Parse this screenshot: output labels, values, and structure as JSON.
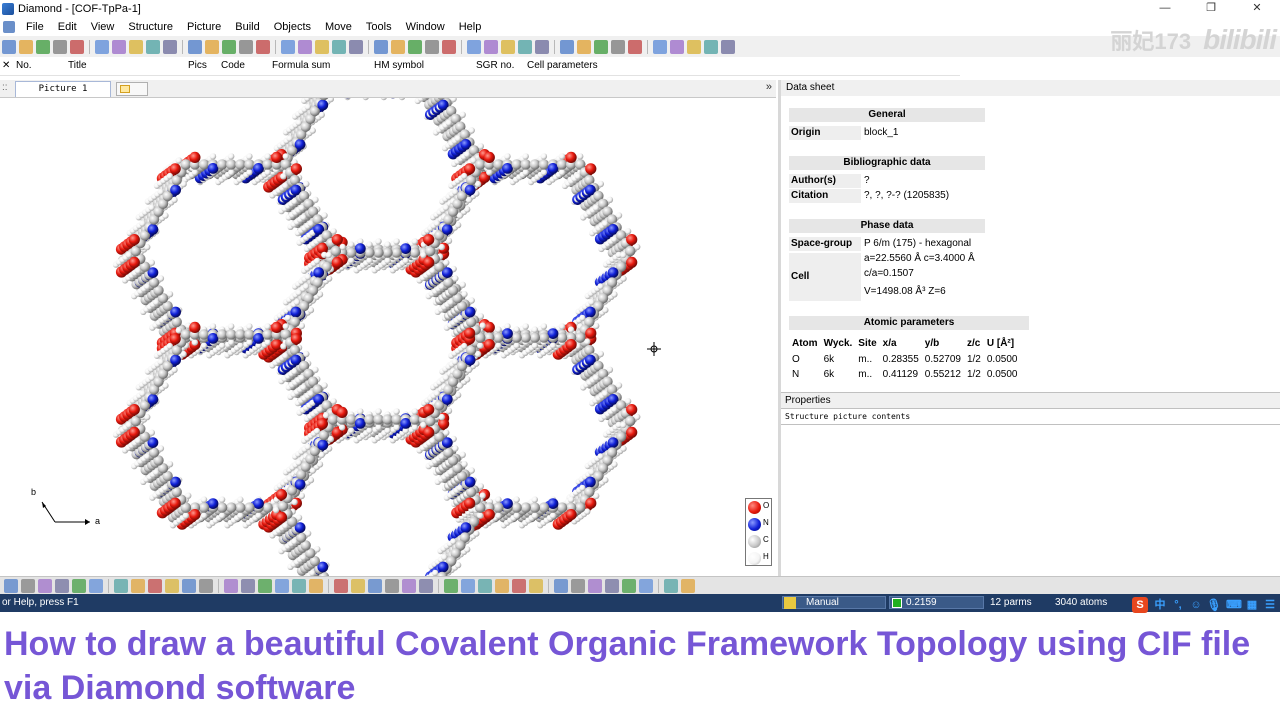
{
  "window": {
    "title": "Diamond - [COF-TpPa-1]",
    "controls": [
      "—",
      "❐",
      "✕"
    ]
  },
  "menu": [
    "File",
    "Edit",
    "View",
    "Structure",
    "Picture",
    "Build",
    "Objects",
    "Move",
    "Tools",
    "Window",
    "Help"
  ],
  "watermark": {
    "text": "丽妃173",
    "logo": "bilibili"
  },
  "columns": {
    "close": "✕",
    "no": "No.",
    "title": "Title",
    "pics": "Pics",
    "code": "Code",
    "formula": "Formula sum",
    "hm": "HM symbol",
    "sgr": "SGR no.",
    "cell": "Cell parameters"
  },
  "tabs": {
    "picture": "Picture 1",
    "more": "»",
    "grip": "::"
  },
  "canvas": {
    "axis_b": "b",
    "axis_a": "a",
    "legend": [
      {
        "symbol": "O",
        "color": "#e8190e"
      },
      {
        "symbol": "N",
        "color": "#1020d8"
      },
      {
        "symbol": "C",
        "color": "#c8c8c8"
      },
      {
        "symbol": "H",
        "color": "#f4f4f4"
      }
    ]
  },
  "datasheet": {
    "header": "Data sheet",
    "general": {
      "title": "General",
      "origin_key": "Origin",
      "origin_val": "block_1"
    },
    "biblio": {
      "title": "Bibliographic data",
      "authors_key": "Author(s)",
      "authors_val": "?",
      "citation_key": "Citation",
      "citation_val": "?, ?, ?-? (1205835)"
    },
    "phase": {
      "title": "Phase data",
      "sg_key": "Space-group",
      "sg_val": "P 6/m (175) - hexagonal",
      "cell_key": "Cell",
      "cell_line1": "a=22.5560 Å  c=3.4000 Å",
      "cell_line2": "c/a=0.1507",
      "cell_line3": "V=1498.08 Å³  Z=6"
    },
    "atomic": {
      "title": "Atomic parameters",
      "headers": [
        "Atom",
        "Wyck.",
        "Site",
        "x/a",
        "y/b",
        "z/c",
        "U [Å²]"
      ],
      "rows": [
        [
          "O",
          "6k",
          "m..",
          "0.28355",
          "0.52709",
          "1/2",
          "0.0500"
        ],
        [
          "N",
          "6k",
          "m..",
          "0.41129",
          "0.55212",
          "1/2",
          "0.0500"
        ]
      ]
    }
  },
  "properties": {
    "header": "Properties",
    "sub": "Structure picture contents"
  },
  "status": {
    "help": "or Help, press F1",
    "mode": "Manual",
    "value": "0.2159",
    "parms": "12 parms",
    "atoms": "3040 atoms",
    "ime": [
      "S",
      "中",
      "°,",
      "☺",
      "⌨",
      "▦",
      "☰"
    ]
  },
  "caption": "How to draw a beautiful Covalent Organic Framework Topology using CIF file via Diamond software",
  "colors": {
    "oxygen": "#e8190e",
    "nitrogen": "#1020d8",
    "carbon": "#c8c8c8",
    "hydrogen": "#f4f4f4",
    "caption": "#7656d6",
    "statusbar": "#1f3b64"
  }
}
